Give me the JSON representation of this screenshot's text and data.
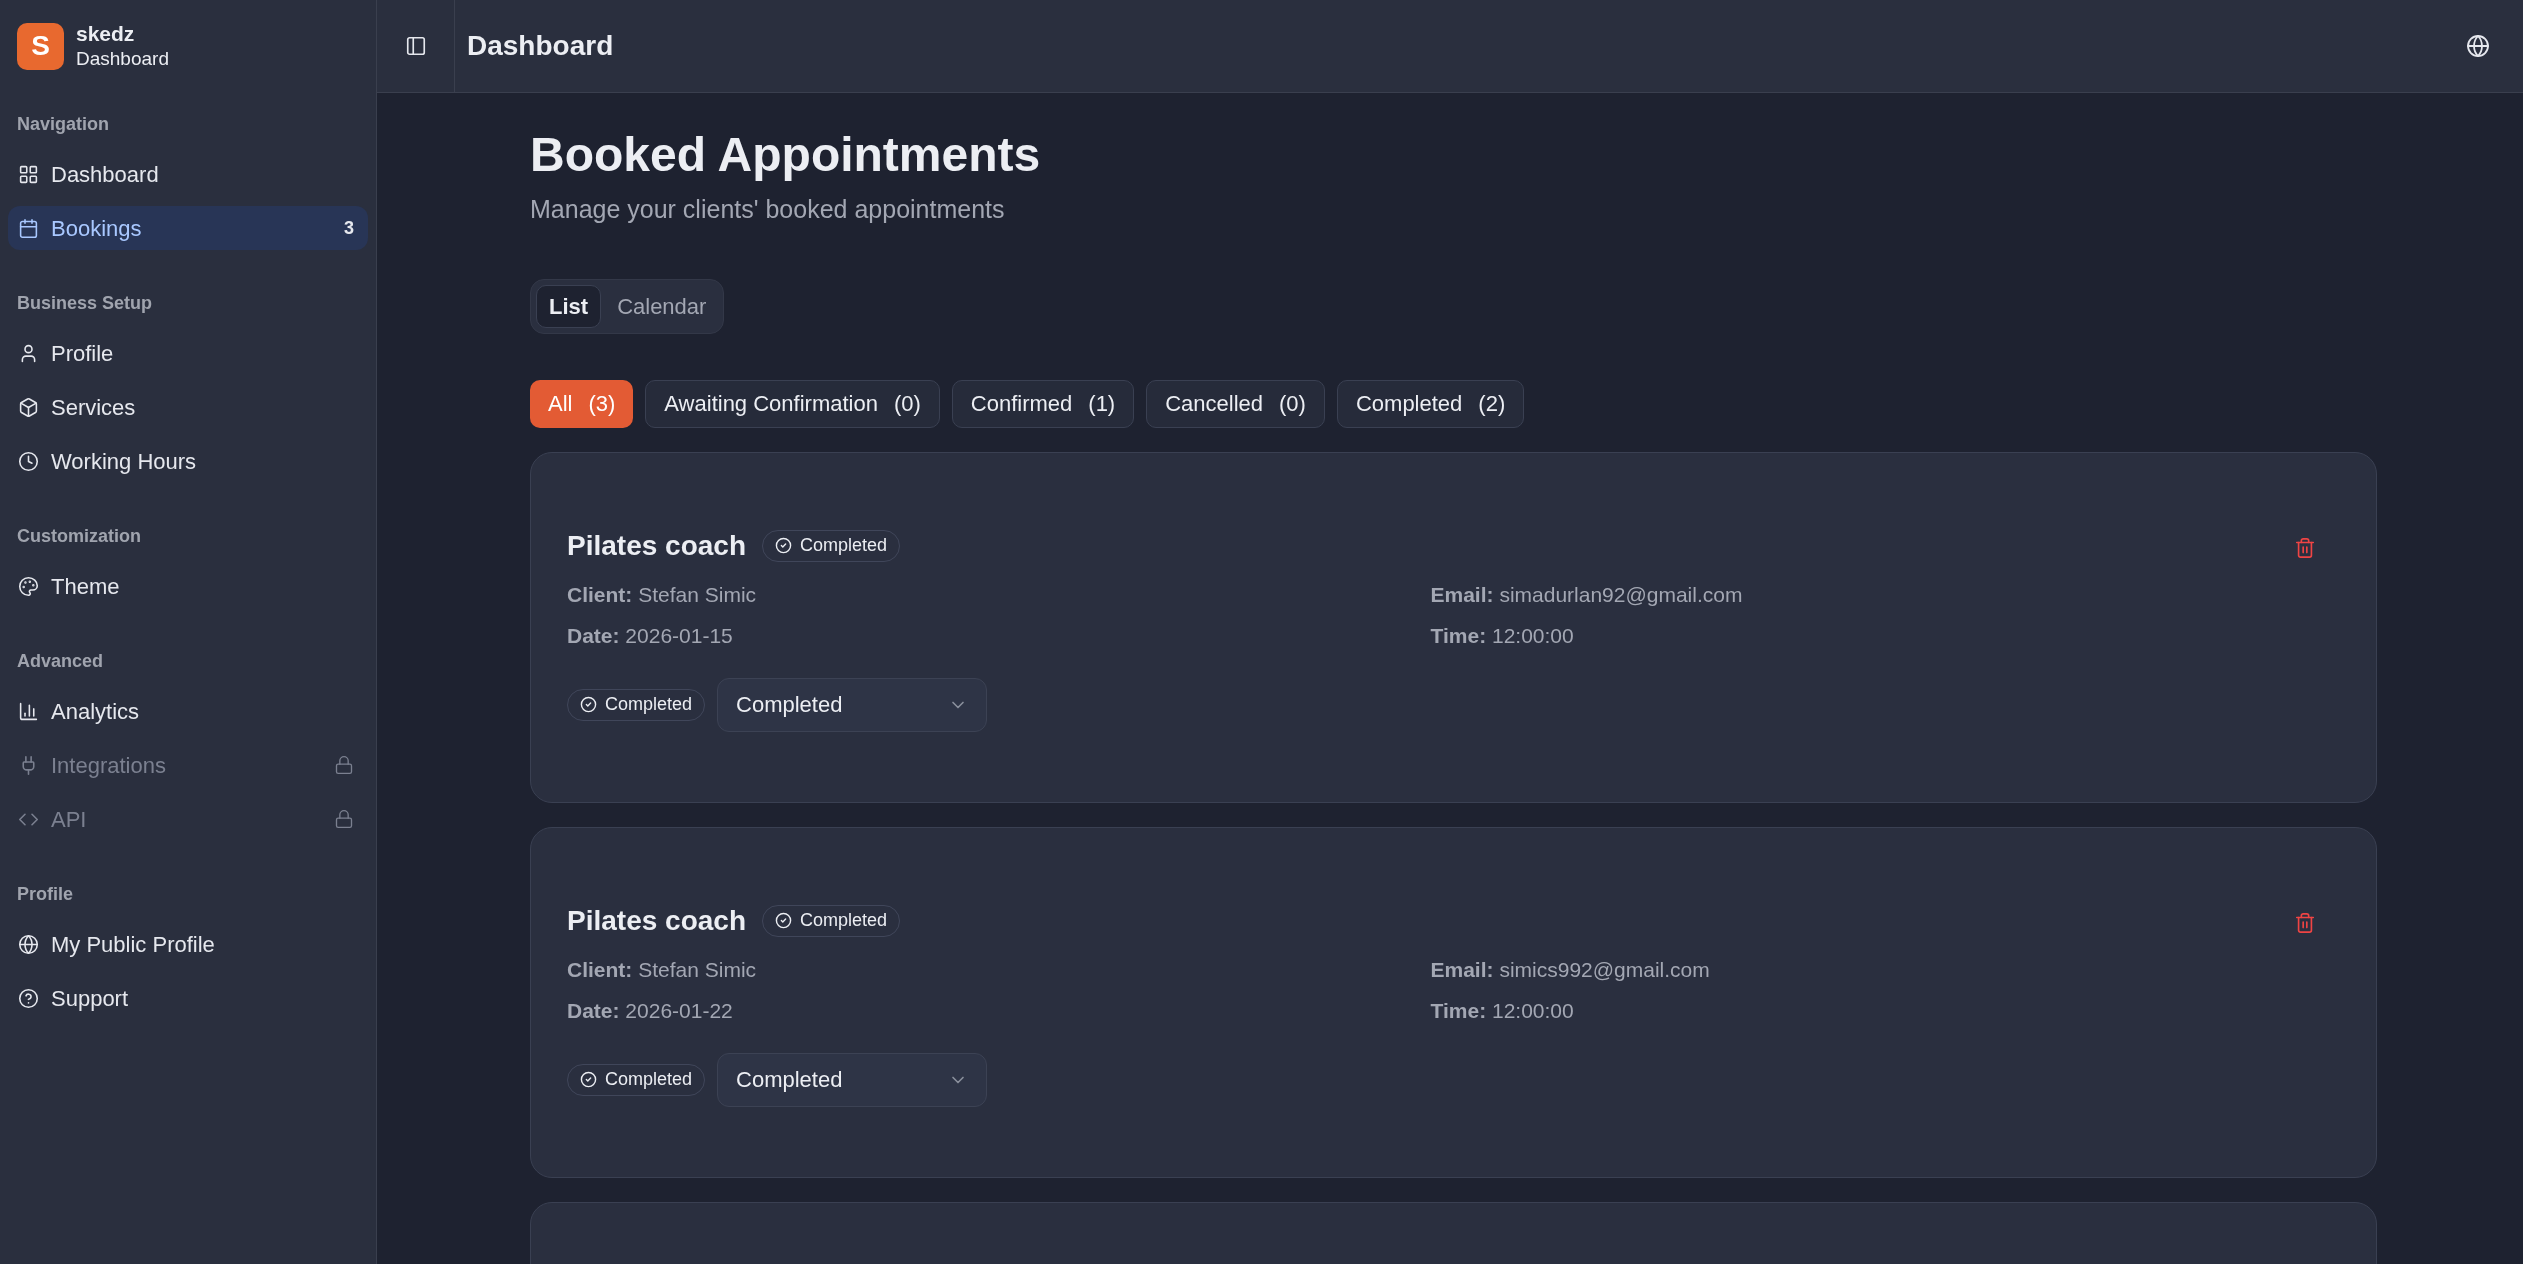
{
  "brand": {
    "logo_letter": "S",
    "name": "skedz",
    "subtitle": "Dashboard"
  },
  "sidebar": {
    "sections": [
      {
        "title": "Navigation",
        "items": [
          {
            "kind": "grid",
            "label": "Dashboard",
            "selected": false,
            "locked": false
          },
          {
            "kind": "calendar",
            "label": "Bookings",
            "selected": true,
            "locked": false,
            "badge": "3"
          }
        ]
      },
      {
        "title": "Business Setup",
        "items": [
          {
            "kind": "user",
            "label": "Profile",
            "selected": false,
            "locked": false
          },
          {
            "kind": "box",
            "label": "Services",
            "selected": false,
            "locked": false
          },
          {
            "kind": "clock",
            "label": "Working Hours",
            "selected": false,
            "locked": false
          }
        ]
      },
      {
        "title": "Customization",
        "items": [
          {
            "kind": "palette",
            "label": "Theme",
            "selected": false,
            "locked": false
          }
        ]
      },
      {
        "title": "Advanced",
        "items": [
          {
            "kind": "chart",
            "label": "Analytics",
            "selected": false,
            "locked": false
          },
          {
            "kind": "plug",
            "label": "Integrations",
            "selected": false,
            "locked": true
          },
          {
            "kind": "code",
            "label": "API",
            "selected": false,
            "locked": true
          }
        ]
      },
      {
        "title": "Profile",
        "items": [
          {
            "kind": "globe",
            "label": "My Public Profile",
            "selected": false,
            "locked": false
          },
          {
            "kind": "help",
            "label": "Support",
            "selected": false,
            "locked": false
          }
        ]
      }
    ]
  },
  "header": {
    "title": "Dashboard"
  },
  "page": {
    "title": "Booked Appointments",
    "subtitle": "Manage your clients' booked appointments"
  },
  "view_tabs": [
    {
      "label": "List",
      "selected": true
    },
    {
      "label": "Calendar",
      "selected": false
    }
  ],
  "filters": [
    {
      "label": "All",
      "count": "(3)",
      "selected": true
    },
    {
      "label": "Awaiting Confirmation",
      "count": "(0)",
      "selected": false
    },
    {
      "label": "Confirmed",
      "count": "(1)",
      "selected": false
    },
    {
      "label": "Cancelled",
      "count": "(0)",
      "selected": false
    },
    {
      "label": "Completed",
      "count": "(2)",
      "selected": false
    }
  ],
  "appointments": [
    {
      "service": "Pilates coach",
      "status": "Completed",
      "client_label": "Client:",
      "client": "Stefan Simic",
      "date_label": "Date:",
      "date": "2026-01-15",
      "email_label": "Email:",
      "email": "simadurlan92@gmail.com",
      "time_label": "Time:",
      "time": "12:00:00",
      "status_chip": "Completed",
      "select_value": "Completed"
    },
    {
      "service": "Pilates coach",
      "status": "Completed",
      "client_label": "Client:",
      "client": "Stefan Simic",
      "date_label": "Date:",
      "date": "2026-01-22",
      "email_label": "Email:",
      "email": "simics992@gmail.com",
      "time_label": "Time:",
      "time": "12:00:00",
      "status_chip": "Completed",
      "select_value": "Completed"
    }
  ],
  "more_cards": [
    {
      "kind": "empty"
    }
  ]
}
